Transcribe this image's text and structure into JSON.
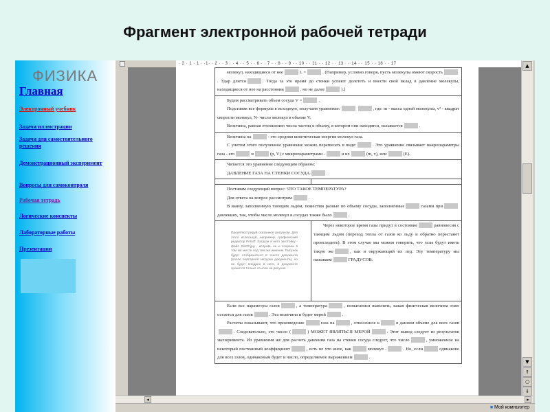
{
  "title": "Фрагмент электронной рабочей тетради",
  "sidebar": {
    "logo": "ФИЗИКА",
    "home": "Главная",
    "items": [
      {
        "label": "Электронный учебник",
        "color": "#d01010"
      },
      {
        "label": "Задачи иллюстрации",
        "color": "#0000c0"
      },
      {
        "label": "Задачи для самостоятельного решения",
        "color": "#0000c0"
      },
      {
        "label": "Демонстрационный эксперимент",
        "color": "#0000c0"
      },
      {
        "label": "Вопросы для самоконтроля",
        "color": "#0000c0"
      },
      {
        "label": "Рабочая тетрадь",
        "color": "#7020a0"
      },
      {
        "label": "Логические конспекты",
        "color": "#0000c0"
      },
      {
        "label": "Лабораторные работы",
        "color": "#0000c0"
      },
      {
        "label": "Презентации",
        "color": "#0000c0"
      }
    ]
  },
  "ruler": "· 2 · 1 · 1 · ·1· · 2 · · 3 · · 4 · · 5 · · 6 · · 7 · · 8 · · 9 · · 10 · · 11 · · 12 · · 13 · · 14 · · 15 · · 16 · · 17",
  "status": {
    "computer": "Мой компьютер"
  },
  "doc": {
    "rows": [
      [
        [
          "молекул, находящиеся от нее",
          "L =",
          ". (Например, условно говоря, пусть молекулы имеют скорость",
          ". Удар длится",
          ". Тогда за это время до стенки успеют долететь и внести свой вклад в давление молекулы, находящиеся от нее на расстоянии",
          ", но не далее",
          ").]"
        ]
      ],
      [
        [
          "Будем рассматривать объем сосуда V =",
          "."
        ],
        [
          "Подставив все формулы в исходную, получаем уравнение:",
          "",
          ",  где: m - масса одной молекулы, v² - квадрат скорости молекул, N- число молекул в объеме V."
        ],
        [
          "Величина, равная отношению числа частиц к объему, в котором они находятся, называется",
          "."
        ]
      ],
      [
        [
          "Величина на",
          "- это средняя кинетическая энергия молекул газа."
        ],
        [
          "С учетом этого полученное уравнение можно переписать в виде:",
          ". Это уравнение связывает макропараметры газа - его",
          "и",
          "(p, V) с микропараметрами -",
          "и их",
          "(m, v), или",
          "(E)."
        ]
      ],
      [
        [
          "Читается это уравнение следующим образом:"
        ],
        [
          "ДАВЛЕНИЕ ГАЗА НА СТЕНКИ СОСУДА",
          "."
        ]
      ],
      [
        [
          "Поставим следующий вопрос: ЧТО ТАКОЕ ТЕМПЕРАТУРА?"
        ],
        [
          "Для ответа на вопрос рассмотрим",
          "."
        ],
        [
          "В ванну, заполненную тающим льдом, поместим разные по объему сосуды, заполненные",
          "газами при",
          "давлениях, так, чтобы число молекул в сосудах также было",
          "."
        ]
      ],
      [
        [
          "Через некоторое время газы придут в состояние",
          "равновесия с тающим льдом (переход тепла от газов ко льду и обратно перестанет происходить). В этом случае мы можем говорить, что газы будут иметь такую же",
          ", как и окружающий их лед. Эту температуру мы называем",
          "ГРАДУСОВ."
        ]
      ],
      [
        [
          "Если все параметры газов",
          ", а температура",
          ", попытаемся выяснить, какая физическая величина тоже остается для газов",
          ". Эта величина и будет мерой",
          "."
        ],
        [
          "Расчеты показывают, что произведение",
          "газа на",
          ", отнесенное к",
          "в данном объеме для всех газов",
          ". Следовательно, это число (",
          ") МОЖЕТ ЯВЛЯТЬСЯ МЕРОЙ",
          ". Этот вывод следует из результатов эксперимента. Из уравнения же для расчета давления газа на стенки сосуда следует, что число",
          ", умноженное на некоторый постоянный коэффициент",
          ", есть не что иное, как",
          "молекул -",
          ". Но, если",
          "одинаково для всех газов, одинаковым будет и число, определяемое выражением",
          "."
        ]
      ]
    ],
    "note": "Проиллюстрируй сказанное рисунком. Для этого используй, например, графический редактор PAINT. Загрузи в него заготовку - файл Ris03.jpg , исправь ее и сохрани в том же месте под тем же именем. Рисунок будет отображаться в тексте документа (после повторной загрузки документа), но не будет внедрен в него, в документе хранится только ссылка на рисунок."
  }
}
